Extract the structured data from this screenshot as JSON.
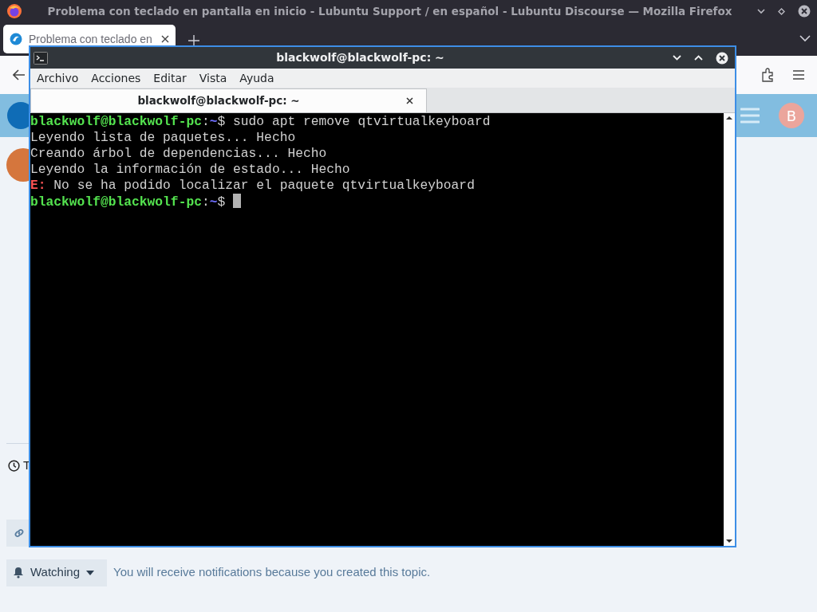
{
  "browser": {
    "window_title": "Problema con teclado en pantalla en inicio - Lubuntu Support / en español - Lubuntu Discourse — Mozilla Firefox",
    "tabs": [
      {
        "label": "Problema con teclado en",
        "selected": true
      }
    ]
  },
  "page": {
    "header_avatar_letter": "B",
    "timeline_letter": "T",
    "notification": {
      "button": "Watching",
      "text": "You will receive notifications because you created this topic."
    }
  },
  "terminal": {
    "title": "blackwolf@blackwolf-pc: ~",
    "menu": [
      "Archivo",
      "Acciones",
      "Editar",
      "Vista",
      "Ayuda"
    ],
    "tabs": [
      {
        "label": "blackwolf@blackwolf-pc: ~",
        "selected": true
      }
    ],
    "lines": [
      {
        "segments": [
          {
            "kind": "user",
            "text": "blackwolf@blackwolf-pc"
          },
          {
            "kind": "plain",
            "text": ":"
          },
          {
            "kind": "path",
            "text": "~"
          },
          {
            "kind": "plain",
            "text": "$ sudo apt remove qtvirtualkeyboard"
          }
        ]
      },
      {
        "segments": [
          {
            "kind": "plain",
            "text": "Leyendo lista de paquetes... Hecho"
          }
        ]
      },
      {
        "segments": [
          {
            "kind": "plain",
            "text": "Creando árbol de dependencias... Hecho"
          }
        ]
      },
      {
        "segments": [
          {
            "kind": "plain",
            "text": "Leyendo la información de estado... Hecho"
          }
        ]
      },
      {
        "segments": [
          {
            "kind": "error",
            "text": "E:"
          },
          {
            "kind": "plain",
            "text": " No se ha podido localizar el paquete qtvirtualkeyboard"
          }
        ]
      },
      {
        "segments": [
          {
            "kind": "user",
            "text": "blackwolf@blackwolf-pc"
          },
          {
            "kind": "plain",
            "text": ":"
          },
          {
            "kind": "path",
            "text": "~"
          },
          {
            "kind": "plain",
            "text": "$ "
          }
        ],
        "cursor": true
      }
    ]
  }
}
